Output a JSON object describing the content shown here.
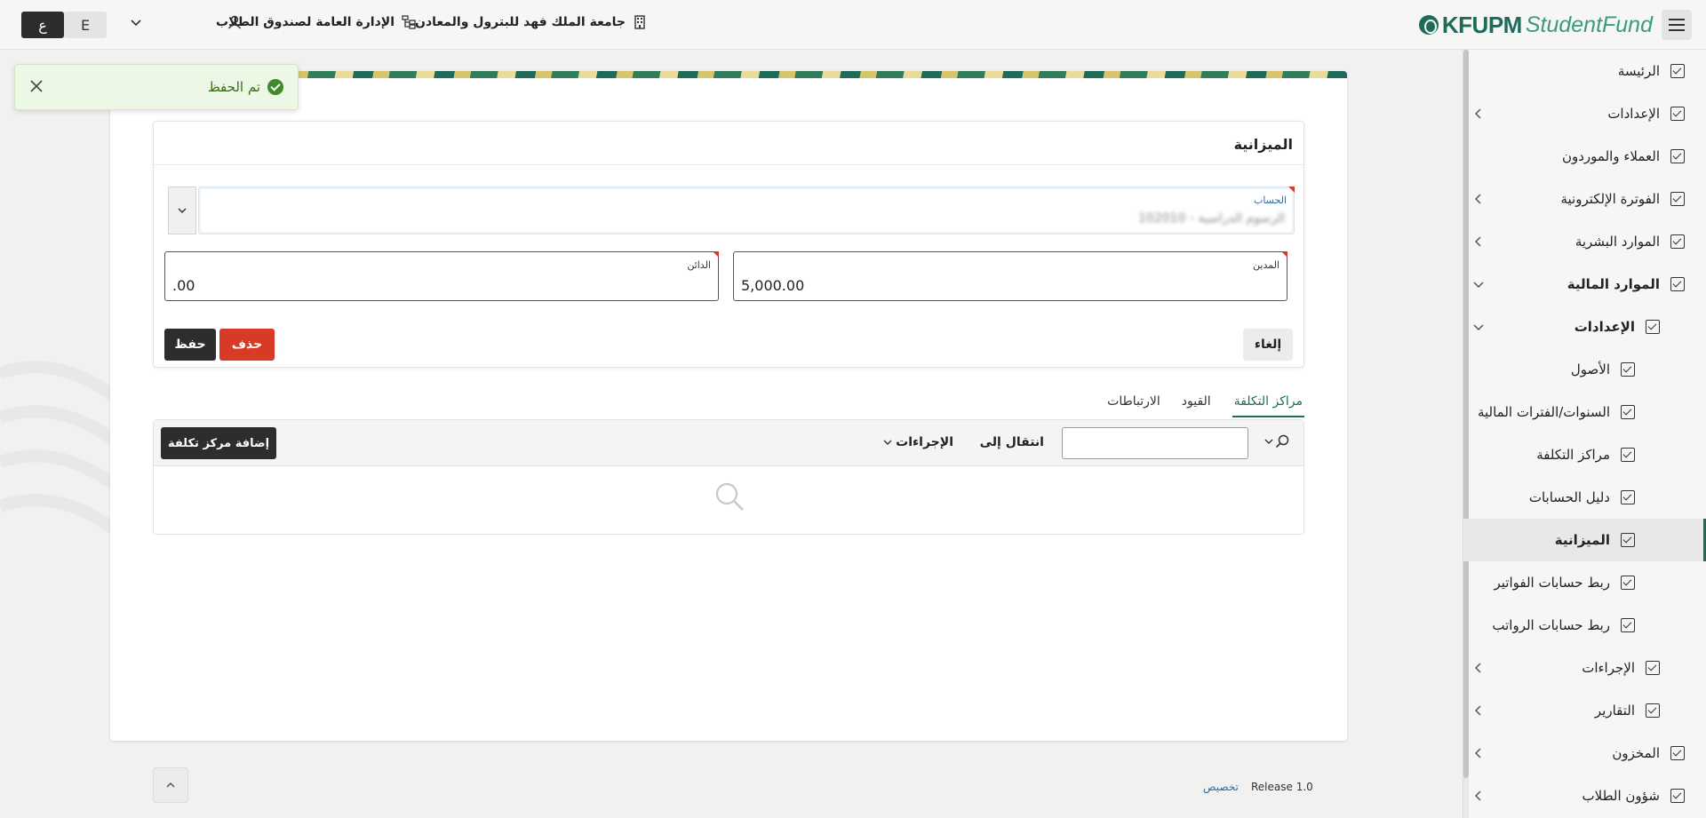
{
  "header": {
    "brand": "KFUPM",
    "brand_sub": "StudentFund",
    "university": "جامعة الملك فهد للبترول والمعادن",
    "department": "الإدارة العامة لصندوق الطلاب",
    "lang_arabic": "ع",
    "lang_english": "E"
  },
  "sidebar": {
    "items": [
      {
        "label": "الرئيسة"
      },
      {
        "label": "الإعدادات"
      },
      {
        "label": "العملاء والموردون"
      },
      {
        "label": "الفوترة الإلكترونية"
      },
      {
        "label": "الموارد البشرية"
      },
      {
        "label": "الموارد المالية"
      },
      {
        "label": "الإعدادات"
      },
      {
        "label": "الأصول"
      },
      {
        "label": "السنوات/الفترات المالية"
      },
      {
        "label": "مراكز التكلفة"
      },
      {
        "label": "دليل الحسابات"
      },
      {
        "label": "الميزانية"
      },
      {
        "label": "ربط حسابات الفواتير"
      },
      {
        "label": "ربط حسابات الرواتب"
      },
      {
        "label": "الإجراءات"
      },
      {
        "label": "التقارير"
      },
      {
        "label": "المخزون"
      },
      {
        "label": "شؤون الطلاب"
      }
    ]
  },
  "toast": {
    "message": "تم الحفظ"
  },
  "budget_form": {
    "title": "الميزانية",
    "account_label": "الحساب",
    "account_value": "102010 - الرسوم الدراسية",
    "debit_label": "المدين",
    "debit_value": "5,000.00",
    "credit_label": "الدائن",
    "credit_value": ".00",
    "cancel_label": "إلغاء",
    "delete_label": "حذف",
    "save_label": "حفظ"
  },
  "tabs": [
    {
      "label": "مراكز التكلفة"
    },
    {
      "label": "القيود"
    },
    {
      "label": "الارتباطات"
    }
  ],
  "report": {
    "search_value": "",
    "goto_label": "انتقال إلى",
    "actions_label": "الإجراءات",
    "add_label": "إضافة مركز تكلفة"
  },
  "footer": {
    "customize_label": "تخصيص",
    "release": "Release 1.0"
  },
  "colors": {
    "brand": "#1f6b5a",
    "danger": "#d93a26",
    "dark_button": "#2d2d2d",
    "success_bg": "#edf7e6"
  }
}
